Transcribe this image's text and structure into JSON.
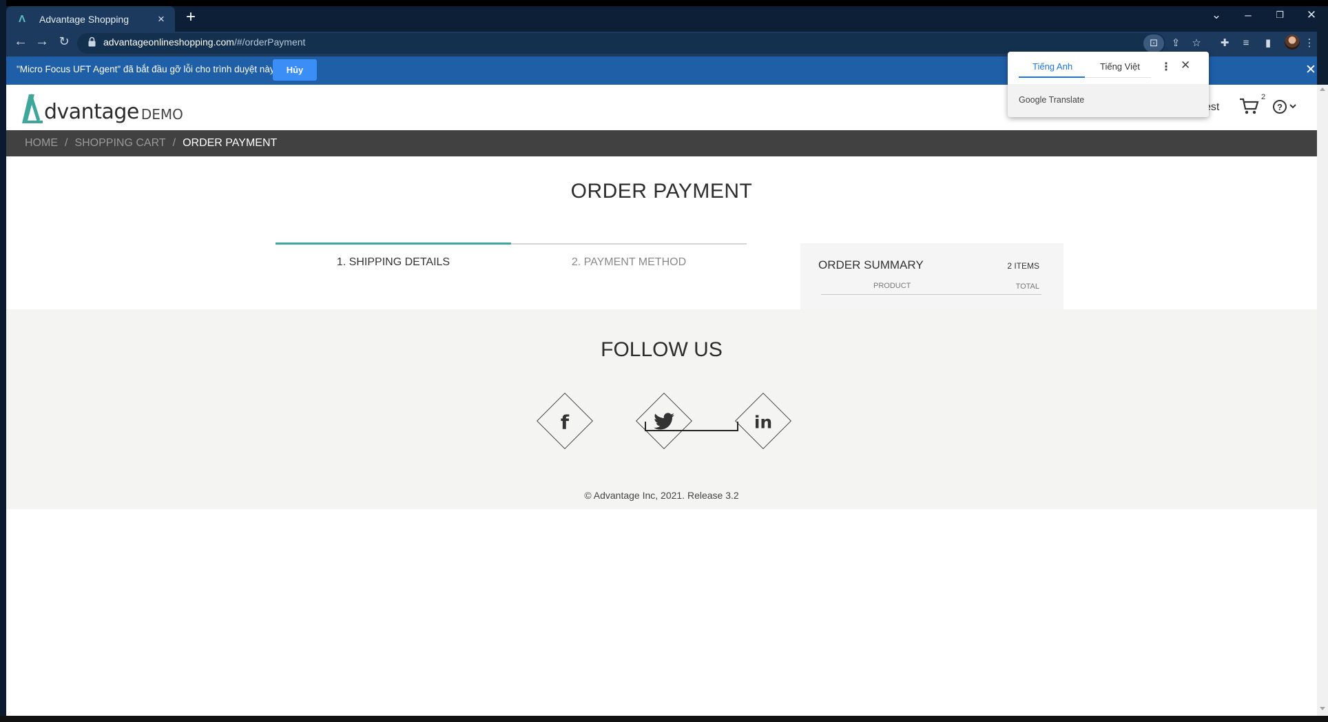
{
  "browser": {
    "tab_title": "Advantage Shopping",
    "url_host": "advantageonlineshopping.com",
    "url_path": "/#/orderPayment"
  },
  "infobar": {
    "message": "\"Micro Focus UFT Agent\" đã bắt đầu gỡ lỗi cho trình duyệt này",
    "cancel_label": "Hủy"
  },
  "translate_popup": {
    "tab_source": "Tiếng Anh",
    "tab_target": "Tiếng Việt",
    "brand": "Google Translate"
  },
  "header": {
    "logo_word": "dvantage",
    "logo_demo": "DEMO",
    "user_truncated": "est",
    "cart_count": "2"
  },
  "breadcrumb": {
    "home": "HOME",
    "cart": "SHOPPING CART",
    "current": "ORDER PAYMENT"
  },
  "main": {
    "title": "ORDER PAYMENT",
    "step1": "1. SHIPPING DETAILS",
    "step2": "2. PAYMENT METHOD",
    "active_step": 1
  },
  "summary": {
    "title": "ORDER SUMMARY",
    "items": "2 ITEMS",
    "col_product": "PRODUCT",
    "col_total": "TOTAL"
  },
  "footer": {
    "follow_title": "FOLLOW US",
    "copyright": "© Advantage Inc, 2021. Release 3.2",
    "social": [
      "facebook-icon",
      "twitter-icon",
      "linkedin-icon"
    ]
  },
  "colors": {
    "accent_teal": "#3fa69a",
    "infobar_blue": "#1f5fa8",
    "breadcrumb_bar": "#414141"
  }
}
